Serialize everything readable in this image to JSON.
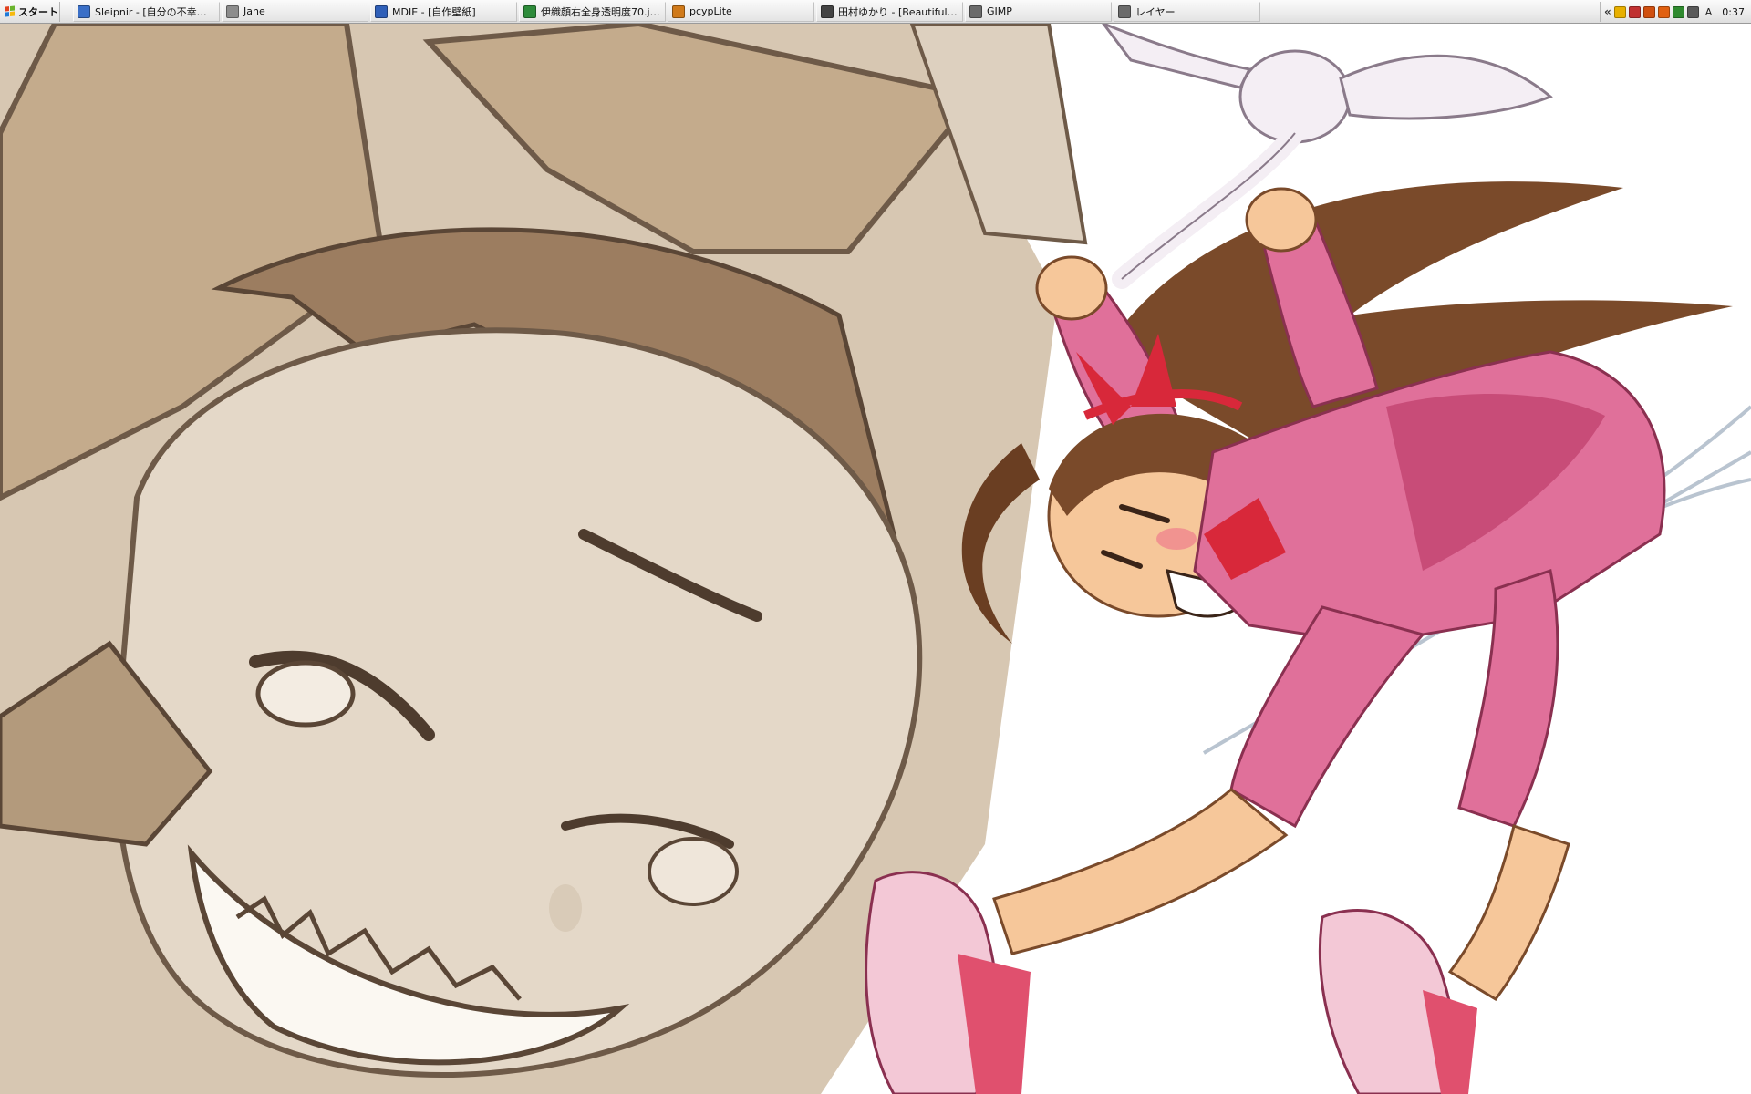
{
  "taskbar": {
    "start_label": "スタート",
    "tasks": [
      {
        "label": "Sleipnir - [自分の不幸が...",
        "icon": "browser-icon",
        "color": "#3a6fc7"
      },
      {
        "label": "Jane",
        "icon": "bbs-reader-icon",
        "color": "#8c8c8c"
      },
      {
        "label": "MDIE - [自作壁紙]",
        "icon": "folder-window-icon",
        "color": "#2f5fb8"
      },
      {
        "label": "伊織顔右全身透明度70.jpg...",
        "icon": "image-viewer-icon",
        "color": "#2d8b3a"
      },
      {
        "label": "pcypLite",
        "icon": "media-player-icon",
        "color": "#d07a1a"
      },
      {
        "label": "田村ゆかり - [Beautiful A...",
        "icon": "music-player-icon",
        "color": "#444444"
      },
      {
        "label": "GIMP",
        "icon": "gimp-icon",
        "color": "#6a6a6a"
      },
      {
        "label": "レイヤー",
        "icon": "gimp-layers-icon",
        "color": "#6a6a6a"
      }
    ],
    "tray": {
      "chevron": "«",
      "icons": [
        {
          "name": "tray-app-icon",
          "color": "#e8b000"
        },
        {
          "name": "tray-network-icon",
          "color": "#c03030"
        },
        {
          "name": "tray-speaker-icon",
          "color": "#d05010"
        },
        {
          "name": "tray-volume-icon",
          "color": "#e06010"
        },
        {
          "name": "tray-meter-icon",
          "color": "#2f8a2f"
        },
        {
          "name": "tray-app2-icon",
          "color": "#5a5a5a"
        }
      ],
      "ime": "A",
      "clock": "0:37"
    }
  },
  "wallpaper": {
    "description_colors": {
      "sepia_light": "#e2d6c6",
      "sepia_mid": "#b9a38a",
      "sepia_dark": "#6e5a48",
      "hair": "#7a4a2a",
      "jacket": "#e0709a",
      "jacket_dark": "#c84c78",
      "ribbon": "#d8283a",
      "skin": "#f6c79a",
      "bunny": "#f4eef4"
    }
  }
}
